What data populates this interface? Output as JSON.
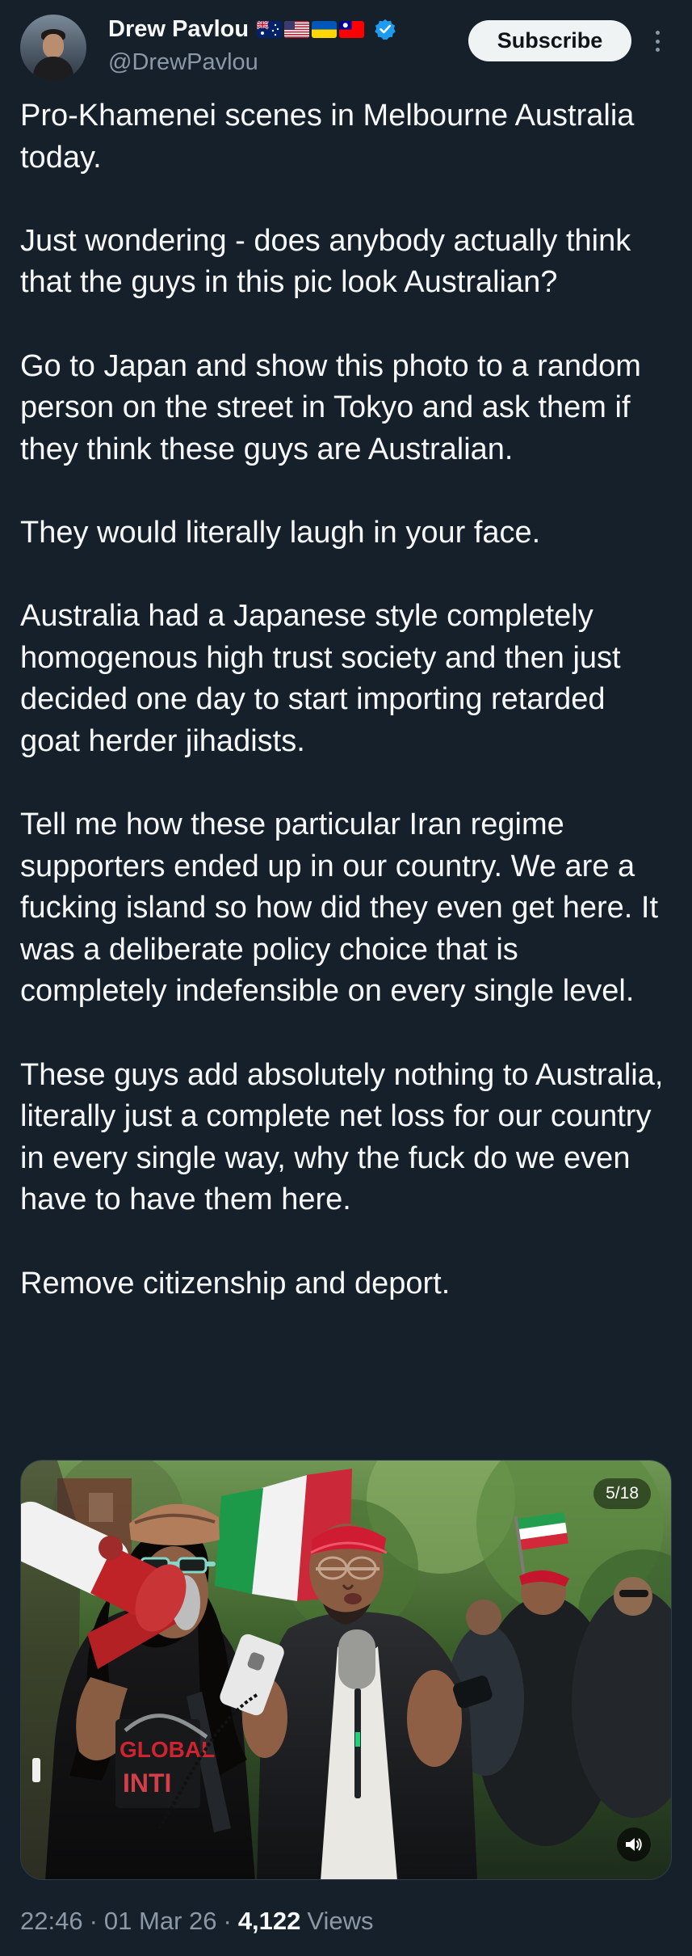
{
  "author": {
    "display_name": "Drew Pavlou",
    "handle": "@DrewPavlou",
    "flags": [
      "australia-flag-icon",
      "usa-flag-icon",
      "ukraine-flag-icon",
      "taiwan-flag-icon"
    ],
    "verified": true
  },
  "actions": {
    "subscribe_label": "Subscribe"
  },
  "tweet": {
    "paragraphs": [
      "Pro-Khamenei scenes in Melbourne Australia today.",
      "Just wondering - does anybody actually think that the guys in this pic look Australian?",
      "Go to Japan and show this photo to a random person on the street in Tokyo and ask them if they think these guys are Australian.",
      "They would literally laugh in your face.",
      "Australia had a Japanese style completely homogenous high trust society and then just decided one day to start importing retarded goat herder jihadists.",
      "Tell me how these particular Iran regime supporters ended up in our country. We are a fucking island so how did they even get here. It was a deliberate policy choice that is completely indefensible on every single level.",
      "These guys add absolutely nothing to Australia, literally just a complete net loss for our country in every single way, why the fuck do we even have to have them here.",
      "Remove citizenship and deport."
    ]
  },
  "media": {
    "counter": "5/18",
    "volume_icon": "volume-icon"
  },
  "meta": {
    "time": "22:46",
    "date": "01 Mar 26",
    "separator": "·",
    "views_count": "4,122",
    "views_label": "Views"
  },
  "colors": {
    "background": "#15202b",
    "text": "#f7f9f9",
    "secondary_text": "#8b98a5",
    "verified_blue": "#1d9bf0",
    "subscribe_bg": "#eff3f4"
  }
}
